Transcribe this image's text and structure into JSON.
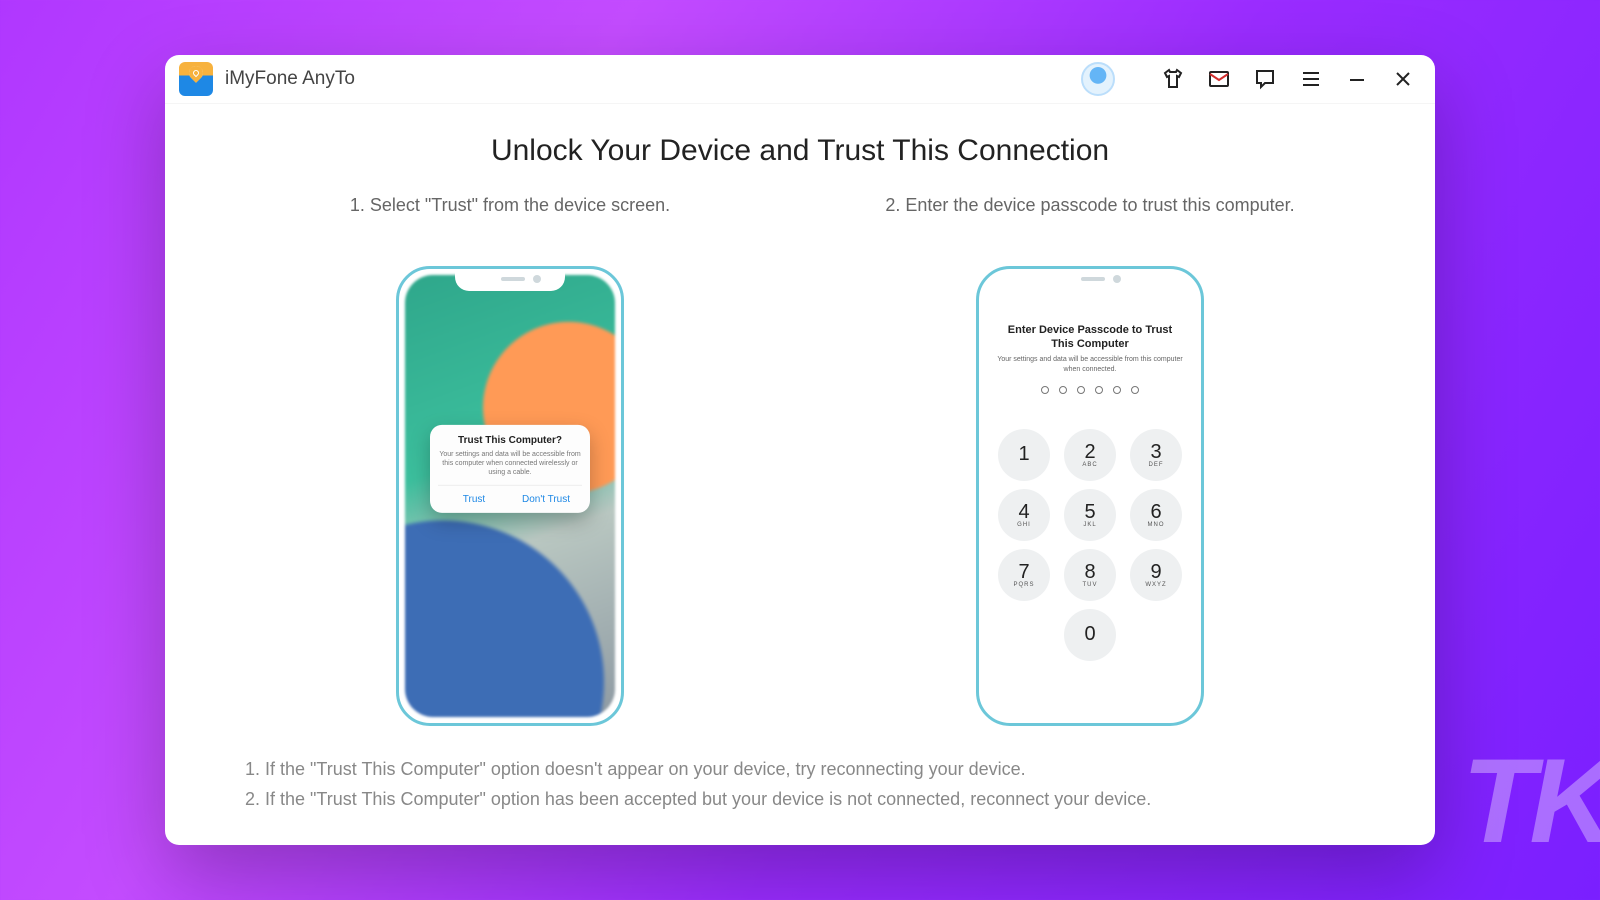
{
  "header": {
    "app_title": "iMyFone AnyTo"
  },
  "page_title": "Unlock Your Device and Trust This Connection",
  "steps": {
    "one": "1. Select \"Trust\" from the device screen.",
    "two": "2. Enter the device passcode to trust this computer."
  },
  "trust_dialog": {
    "title": "Trust This Computer?",
    "body": "Your settings and data will be accessible from this computer when connected wirelessly or using a cable.",
    "trust": "Trust",
    "dont_trust": "Don't Trust"
  },
  "passcode": {
    "title": "Enter Device Passcode to Trust This Computer",
    "subtitle": "Your settings and data will be accessible from this computer when connected.",
    "keys": {
      "k1": "1",
      "k2": "2",
      "k3": "3",
      "k4": "4",
      "k5": "5",
      "k6": "6",
      "k7": "7",
      "k8": "8",
      "k9": "9",
      "k0": "0",
      "l2": "ABC",
      "l3": "DEF",
      "l4": "GHI",
      "l5": "JKL",
      "l6": "MNO",
      "l7": "PQRS",
      "l8": "TUV",
      "l9": "WXYZ"
    }
  },
  "notes": {
    "n1": "1. If the \"Trust This Computer\" option doesn't appear on your device, try reconnecting your device.",
    "n2": "2. If the \"Trust This Computer\" option has been accepted but your device is not connected, reconnect your device."
  },
  "watermark": "TK"
}
